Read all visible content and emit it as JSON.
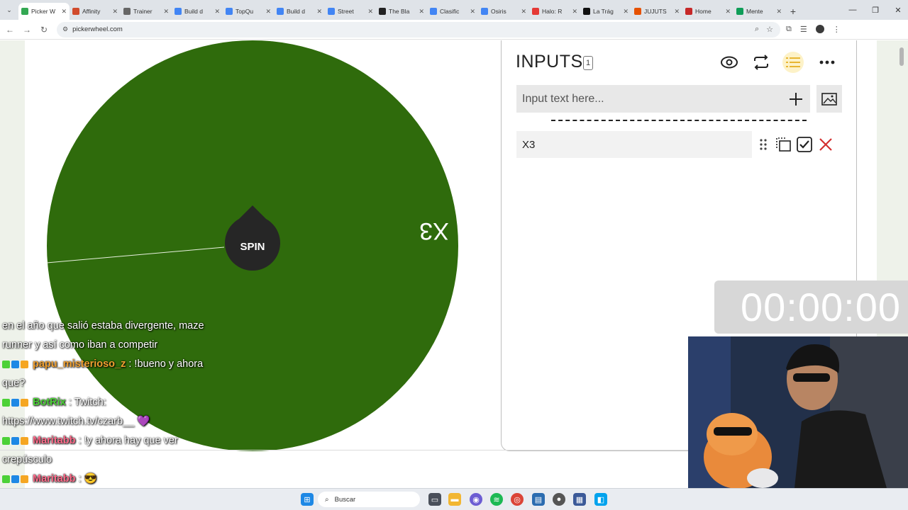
{
  "browser": {
    "tabs": [
      {
        "label": "Picker W",
        "color": "#34a853",
        "active": true
      },
      {
        "label": "Affinity",
        "color": "#d14b2c"
      },
      {
        "label": "Trainer",
        "color": "#666666"
      },
      {
        "label": "Build d",
        "color": "#4285f4"
      },
      {
        "label": "TopQu",
        "color": "#4285f4"
      },
      {
        "label": "Build d",
        "color": "#4285f4"
      },
      {
        "label": "Street",
        "color": "#4285f4"
      },
      {
        "label": "The Bla",
        "color": "#222222"
      },
      {
        "label": "Clasific",
        "color": "#4285f4"
      },
      {
        "label": "Osiris",
        "color": "#4285f4"
      },
      {
        "label": "Halo: R",
        "color": "#e53935"
      },
      {
        "label": "La Trág",
        "color": "#111111"
      },
      {
        "label": "JUJUTS",
        "color": "#e65100"
      },
      {
        "label": "Home",
        "color": "#c62828"
      },
      {
        "label": "Mente",
        "color": "#0f9d58"
      }
    ],
    "url": "pickerwheel.com"
  },
  "wheel": {
    "color": "#2f6b0c",
    "segment_label": "X3",
    "spin_label": "SPIN"
  },
  "inputs_panel": {
    "title": "INPUTS",
    "count": "1",
    "placeholder": "Input text here...",
    "entries": [
      {
        "text": "X3"
      }
    ],
    "icons": [
      "eye-icon",
      "shuffle-icon",
      "list-icon",
      "more-icon"
    ]
  },
  "timer": "00:00:00",
  "chat": {
    "lines": [
      {
        "user": "",
        "text": "en el año que salió estaba divergente, maze"
      },
      {
        "user": "",
        "text": "runner y así como iban a competir"
      },
      {
        "user": "papu_misterioso_z",
        "user_color": "#f0a030",
        "text": ": !bueno y ahora"
      },
      {
        "user": "",
        "text": "que?"
      },
      {
        "user": "BotRix",
        "user_color": "#4cd137",
        "text": ": Twitch:"
      },
      {
        "user": "",
        "text": "https://www.twitch.tv/czarb__ 💜"
      },
      {
        "user": "Maritabb",
        "user_color": "#ff6b8a",
        "text": ": !y ahora hay que ver"
      },
      {
        "user": "",
        "text": "crepúsculo"
      },
      {
        "user": "Maritabb",
        "user_color": "#ff6b8a",
        "text": ": 😎"
      },
      {
        "user": "Maritabb",
        "user_color": "#ff6b8a",
        "text": ": 🟫"
      }
    ]
  },
  "taskbar": {
    "search_label": "Buscar"
  }
}
